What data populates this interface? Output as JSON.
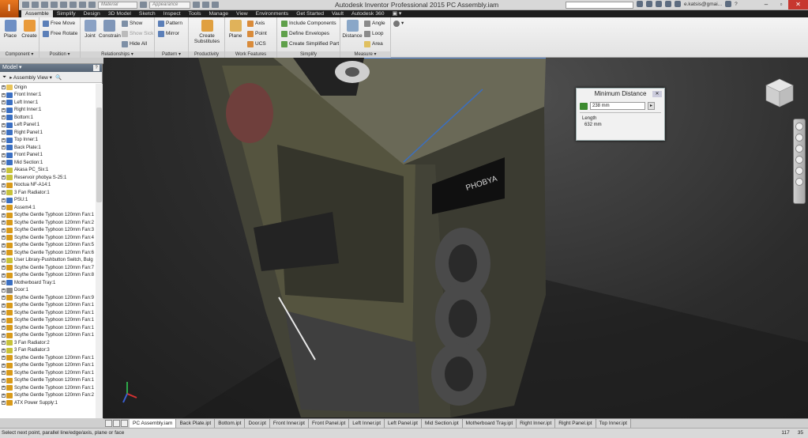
{
  "app": {
    "logo": "I",
    "title": "Autodesk Inventor Professional 2015   PC Assembly.iam",
    "material_placeholder": "Material",
    "appearance_placeholder": "Appearance",
    "search_placeholder": "",
    "user": "e.katsis@gmai...",
    "help": "?"
  },
  "tabs": [
    "Assemble",
    "Simplify",
    "Design",
    "3D Model",
    "Sketch",
    "Inspect",
    "Tools",
    "Manage",
    "View",
    "Environments",
    "Get Started",
    "Vault",
    "Autodesk 360"
  ],
  "active_tab": "Assemble",
  "ribbon": {
    "component": {
      "label": "Component ▾",
      "place": "Place",
      "create": "Create"
    },
    "position": {
      "label": "Position ▾",
      "free_move": "Free Move",
      "free_rotate": "Free Rotate"
    },
    "relationships": {
      "label": "Relationships ▾",
      "joint": "Joint",
      "constrain": "Constrain",
      "show": "Show",
      "show_sick": "Show Sick",
      "hide_all": "Hide All"
    },
    "pattern": {
      "label": "Pattern ▾",
      "pattern": "Pattern",
      "mirror": "Mirror"
    },
    "productivity": {
      "label": "Productivity",
      "create_substitutes": "Create Substitutes"
    },
    "work_features": {
      "label": "Work Features",
      "plane": "Plane",
      "axis": "Axis",
      "point": "Point",
      "ucs": "UCS"
    },
    "simplify": {
      "label": "Simplify",
      "include": "Include Components",
      "define": "Define Envelopes",
      "create_simplified": "Create Simplified Part"
    },
    "measure": {
      "label": "Measure ▾",
      "distance": "Distance",
      "angle": "Angle",
      "loop": "Loop",
      "area": "Area"
    }
  },
  "browser": {
    "title": "Model ▾",
    "help": "?",
    "view_label": "Assembly View",
    "items": [
      {
        "label": "Origin",
        "icon": "folder"
      },
      {
        "label": "Front Inner:1",
        "icon": "part"
      },
      {
        "label": "Left Inner:1",
        "icon": "part"
      },
      {
        "label": "Right Inner:1",
        "icon": "part"
      },
      {
        "label": "Bottom:1",
        "icon": "part"
      },
      {
        "label": "Left Panel:1",
        "icon": "part"
      },
      {
        "label": "Right Panel:1",
        "icon": "part"
      },
      {
        "label": "Top Inner:1",
        "icon": "part"
      },
      {
        "label": "Back Plate:1",
        "icon": "part"
      },
      {
        "label": "Front Panel:1",
        "icon": "part"
      },
      {
        "label": "Mid Section:1",
        "icon": "part"
      },
      {
        "label": "Akasa PC_Six:1",
        "icon": "assembly-yellow"
      },
      {
        "label": "Reservoir phobya S-25:1",
        "icon": "assembly-yellow"
      },
      {
        "label": "Noctua NF-A14:1",
        "icon": "assembly"
      },
      {
        "label": "3 Fan Radiator:1",
        "icon": "assembly-yellow"
      },
      {
        "label": "PSU:1",
        "icon": "part"
      },
      {
        "label": "Assem4:1",
        "icon": "assembly"
      },
      {
        "label": "Scythe Gentle Typhoon 120mm Fan:1",
        "icon": "assembly"
      },
      {
        "label": "Scythe Gentle Typhoon 120mm Fan:2",
        "icon": "assembly"
      },
      {
        "label": "Scythe Gentle Typhoon 120mm Fan:3",
        "icon": "assembly"
      },
      {
        "label": "Scythe Gentle Typhoon 120mm Fan:4",
        "icon": "assembly"
      },
      {
        "label": "Scythe Gentle Typhoon 120mm Fan:5",
        "icon": "assembly"
      },
      {
        "label": "Scythe Gentle Typhoon 120mm Fan:6",
        "icon": "assembly"
      },
      {
        "label": "User Library-Pushbutton Switch, Bulg",
        "icon": "assembly-yellow"
      },
      {
        "label": "Scythe Gentle Typhoon 120mm Fan:7",
        "icon": "assembly"
      },
      {
        "label": "Scythe Gentle Typhoon 120mm Fan:8",
        "icon": "assembly"
      },
      {
        "label": "Motherboard Tray:1",
        "icon": "part"
      },
      {
        "label": "Door:1",
        "icon": "part-gray"
      },
      {
        "label": "Scythe Gentle Typhoon 120mm Fan:9",
        "icon": "assembly"
      },
      {
        "label": "Scythe Gentle Typhoon 120mm Fan:1",
        "icon": "assembly"
      },
      {
        "label": "Scythe Gentle Typhoon 120mm Fan:1",
        "icon": "assembly"
      },
      {
        "label": "Scythe Gentle Typhoon 120mm Fan:1",
        "icon": "assembly"
      },
      {
        "label": "Scythe Gentle Typhoon 120mm Fan:1",
        "icon": "assembly"
      },
      {
        "label": "Scythe Gentle Typhoon 120mm Fan:1",
        "icon": "assembly"
      },
      {
        "label": "3 Fan Radiator:2",
        "icon": "assembly-yellow"
      },
      {
        "label": "3 Fan Radiator:3",
        "icon": "assembly-yellow"
      },
      {
        "label": "Scythe Gentle Typhoon 120mm Fan:1",
        "icon": "assembly"
      },
      {
        "label": "Scythe Gentle Typhoon 120mm Fan:1",
        "icon": "assembly"
      },
      {
        "label": "Scythe Gentle Typhoon 120mm Fan:1",
        "icon": "assembly"
      },
      {
        "label": "Scythe Gentle Typhoon 120mm Fan:1",
        "icon": "assembly"
      },
      {
        "label": "Scythe Gentle Typhoon 120mm Fan:1",
        "icon": "assembly"
      },
      {
        "label": "Scythe Gentle Typhoon 120mm Fan:2",
        "icon": "assembly"
      },
      {
        "label": "ATX Power Supply:1",
        "icon": "assembly"
      }
    ]
  },
  "dialog": {
    "title": "Minimum Distance",
    "distance_value": "238 mm",
    "length_label": "Length",
    "length_value": "632 mm",
    "close": "✕"
  },
  "reservoir_text": "PHOBYA",
  "doc_tabs": [
    "PC Assembly.iam",
    "Back Plate.ipt",
    "Bottom.ipt",
    "Door.ipt",
    "Front Inner.ipt",
    "Front Panel.ipt",
    "Left Inner.ipt",
    "Left Panel.ipt",
    "Mid Section.ipt",
    "Motherboard Tray.ipt",
    "Right Inner.ipt",
    "Right Panel.ipt",
    "Top Inner.ipt"
  ],
  "active_doc_tab": "PC Assembly.iam",
  "status": {
    "message": "Select next point, parallel line/edge/axis, plane or face",
    "num1": "117",
    "num2": "35"
  },
  "colors": {
    "part_icon": "#3a6fc2",
    "assembly_icon": "#d89a1a",
    "accent_blue": "#3a6fc2"
  }
}
